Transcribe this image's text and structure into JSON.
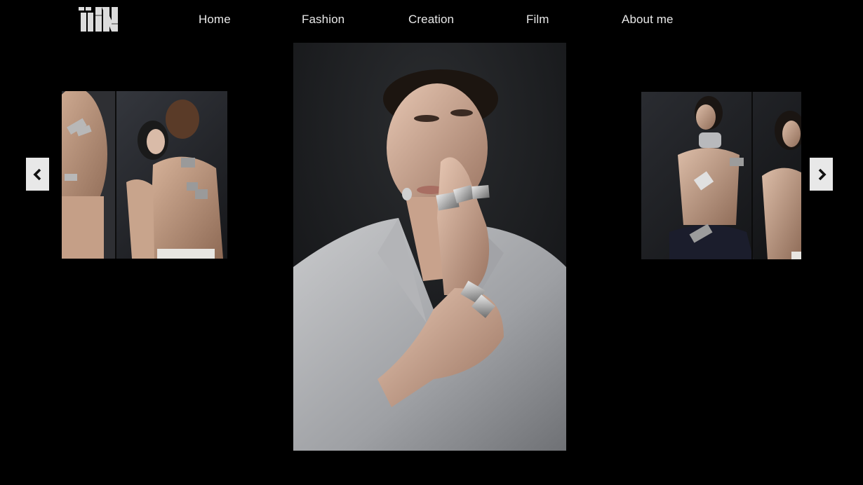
{
  "brand": {
    "logo_text": "IIDN",
    "logo_icon": "brand-logo-icon"
  },
  "nav": {
    "items": [
      {
        "label": "Home"
      },
      {
        "label": "Fashion"
      },
      {
        "label": "Creation"
      },
      {
        "label": "Film"
      },
      {
        "label": "About me"
      }
    ]
  },
  "carousel": {
    "prev_icon": "chevron-left-icon",
    "next_icon": "chevron-right-icon"
  },
  "colors": {
    "background": "#000000",
    "nav_text": "#e9e9e9",
    "arrow_bg": "#e8e8e8",
    "arrow_icon": "#111111"
  }
}
